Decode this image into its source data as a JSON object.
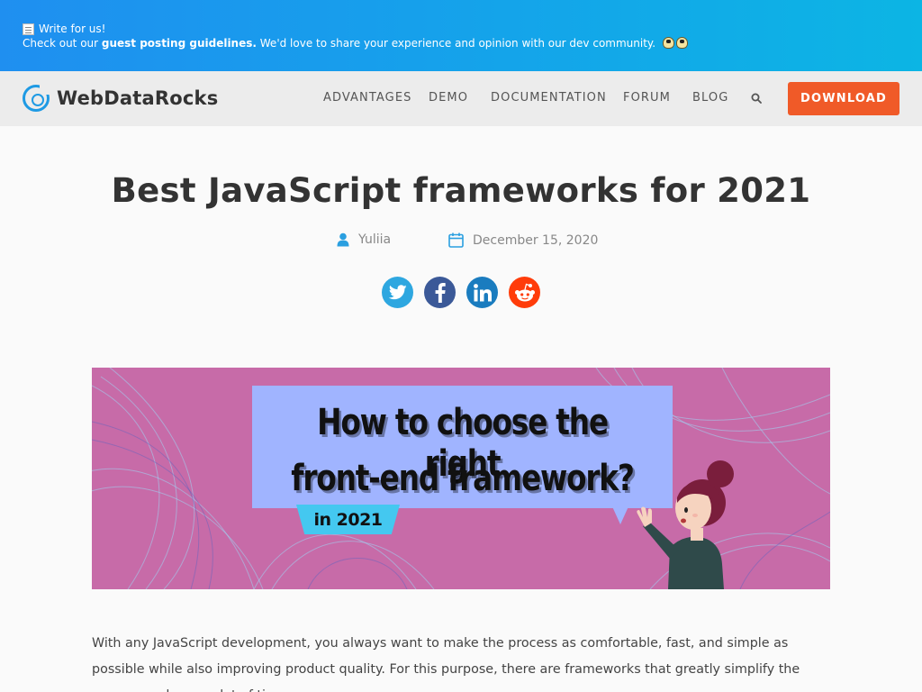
{
  "promo": {
    "line1": "Write for us!",
    "line2_prefix": "Check out our ",
    "line2_bold": "guest posting guidelines.",
    "line2_suffix": " We'd love to share your experience and opinion with our dev community.",
    "icons": [
      "memo-icon",
      "penguin-icon",
      "penguin-icon"
    ]
  },
  "nav": {
    "logo_text": "WebDataRocks",
    "items": [
      "ADVANTAGES",
      "DEMO",
      "DOCUMENTATION",
      "FORUM",
      "BLOG"
    ],
    "download_label": "DOWNLOAD"
  },
  "article": {
    "title": "Best JavaScript frameworks for 2021",
    "author": "Yuliia",
    "date": "December 15, 2020",
    "share": [
      "twitter",
      "facebook",
      "linkedin",
      "reddit"
    ]
  },
  "hero": {
    "line1": "How to choose the right",
    "line2": "front-end framework?",
    "tag": "in 2021"
  },
  "body": {
    "paragraph": "With any JavaScript development, you always want to make the process as comfortable, fast, and simple as possible while also improving product quality. For this purpose, there are frameworks that greatly simplify the process and save a lot of time."
  },
  "colors": {
    "brand": "#1e9ae4",
    "download": "#f05a28",
    "hero_bg": "#c76ba8",
    "bubble": "#a0b4ff"
  }
}
